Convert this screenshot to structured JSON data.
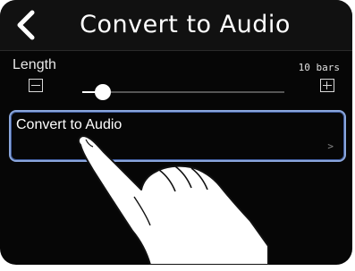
{
  "header": {
    "back_icon": "chevron-left-icon",
    "title": "Convert to Audio"
  },
  "length": {
    "label": "Length",
    "value": "10 bars",
    "slider_level": 0.1,
    "minus_icon": "minus-icon",
    "plus_icon": "plus-icon"
  },
  "menu": {
    "convert_label": "Convert to Audio",
    "chevron": ">"
  },
  "colors": {
    "screen_background": "#060606",
    "selection_outline": "#8aa6dc",
    "text": "#ffffff"
  }
}
